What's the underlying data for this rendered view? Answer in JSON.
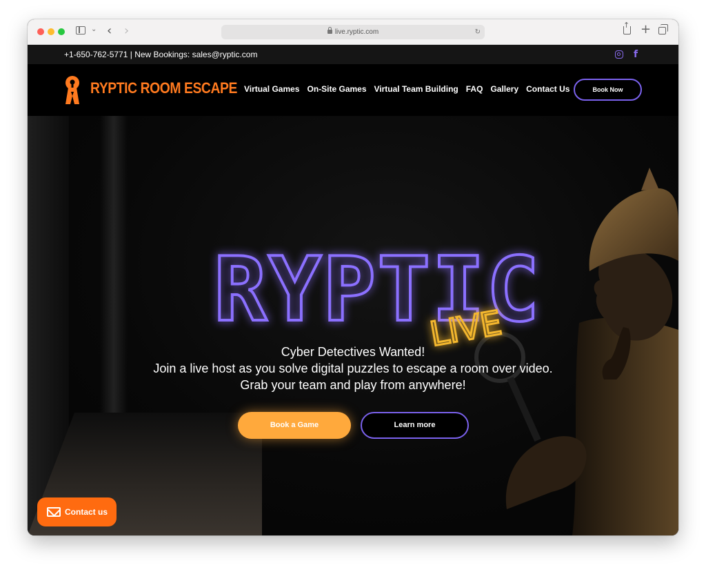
{
  "browser": {
    "url": "live.ryptic.com"
  },
  "topbar": {
    "contact_text": "+1-650-762-5771 | New Bookings: sales@ryptic.com"
  },
  "header": {
    "logo_text": "RYPTIC ROOM ESCAPE",
    "nav": [
      "Virtual Games",
      "On-Site Games",
      "Virtual Team Building",
      "FAQ",
      "Gallery",
      "Contact Us"
    ],
    "book_now": "Book Now"
  },
  "hero": {
    "neon_title": "RYPTIC",
    "neon_subtitle": "LIVE",
    "lines": [
      "Cyber Detectives Wanted!",
      "Join a live host as you solve digital puzzles to escape a room over video.",
      "Grab your team and play from anywhere!"
    ],
    "book_button": "Book a Game",
    "learn_button": "Learn more"
  },
  "contact_widget": {
    "label": "Contact us"
  },
  "colors": {
    "accent_purple": "#7b62ee",
    "accent_orange": "#ffa93c",
    "brand_orange": "#ff7a1f",
    "neon_yellow": "#f5b82e"
  }
}
